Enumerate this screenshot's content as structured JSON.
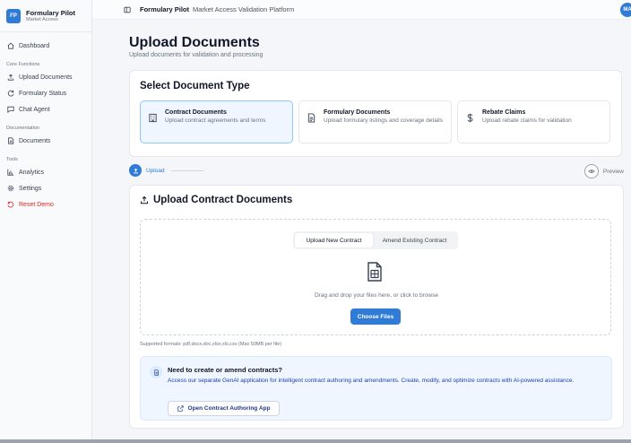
{
  "brand": {
    "logo_text": "FP",
    "name": "Formulary Pilot",
    "tagline": "Market Access"
  },
  "sidebar": {
    "dashboard": "Dashboard",
    "section_core": "Core Functions",
    "upload": "Upload Documents",
    "formulary_status": "Formulary Status",
    "chat_agent": "Chat Agent",
    "section_docs": "Documentation",
    "documents": "Documents",
    "section_tools": "Tools",
    "analytics": "Analytics",
    "settings": "Settings",
    "reset_demo": "Reset Demo"
  },
  "header": {
    "title": "Formulary Pilot",
    "subtitle": "Market Access Validation Platform",
    "avatar": "MA"
  },
  "page": {
    "title": "Upload Documents",
    "subtitle": "Upload documents for validation and processing"
  },
  "doc_type": {
    "heading": "Select Document Type",
    "options": [
      {
        "label": "Contract Documents",
        "desc": "Upload contract agreements and terms",
        "icon": "building-icon"
      },
      {
        "label": "Formulary Documents",
        "desc": "Upload formulary listings and coverage details",
        "icon": "document-icon"
      },
      {
        "label": "Rebate Claims",
        "desc": "Upload rebate claims for validation",
        "icon": "dollar-icon"
      }
    ]
  },
  "steps": {
    "upload": "Upload",
    "preview": "Preview"
  },
  "upload": {
    "title": "Upload Contract Documents",
    "tab_new": "Upload New Contract",
    "tab_amend": "Amend Existing Contract",
    "drop_text": "Drag and drop your files here, or click to browse",
    "choose_button": "Choose Files",
    "formats": "Supported formats: pdf,docx,doc,xlsx,xls,csv (Max 50MB per file)"
  },
  "info": {
    "title": "Need to create or amend contracts?",
    "desc": "Access our separate GenAI application for intelligent contract authoring and amendments. Create, modify, and optimize contracts with AI-powered assistance.",
    "button": "Open Contract Authoring App"
  },
  "colors": {
    "accent": "#2f7bd6",
    "danger": "#dc2626",
    "selected_bg": "#eff6ff"
  }
}
